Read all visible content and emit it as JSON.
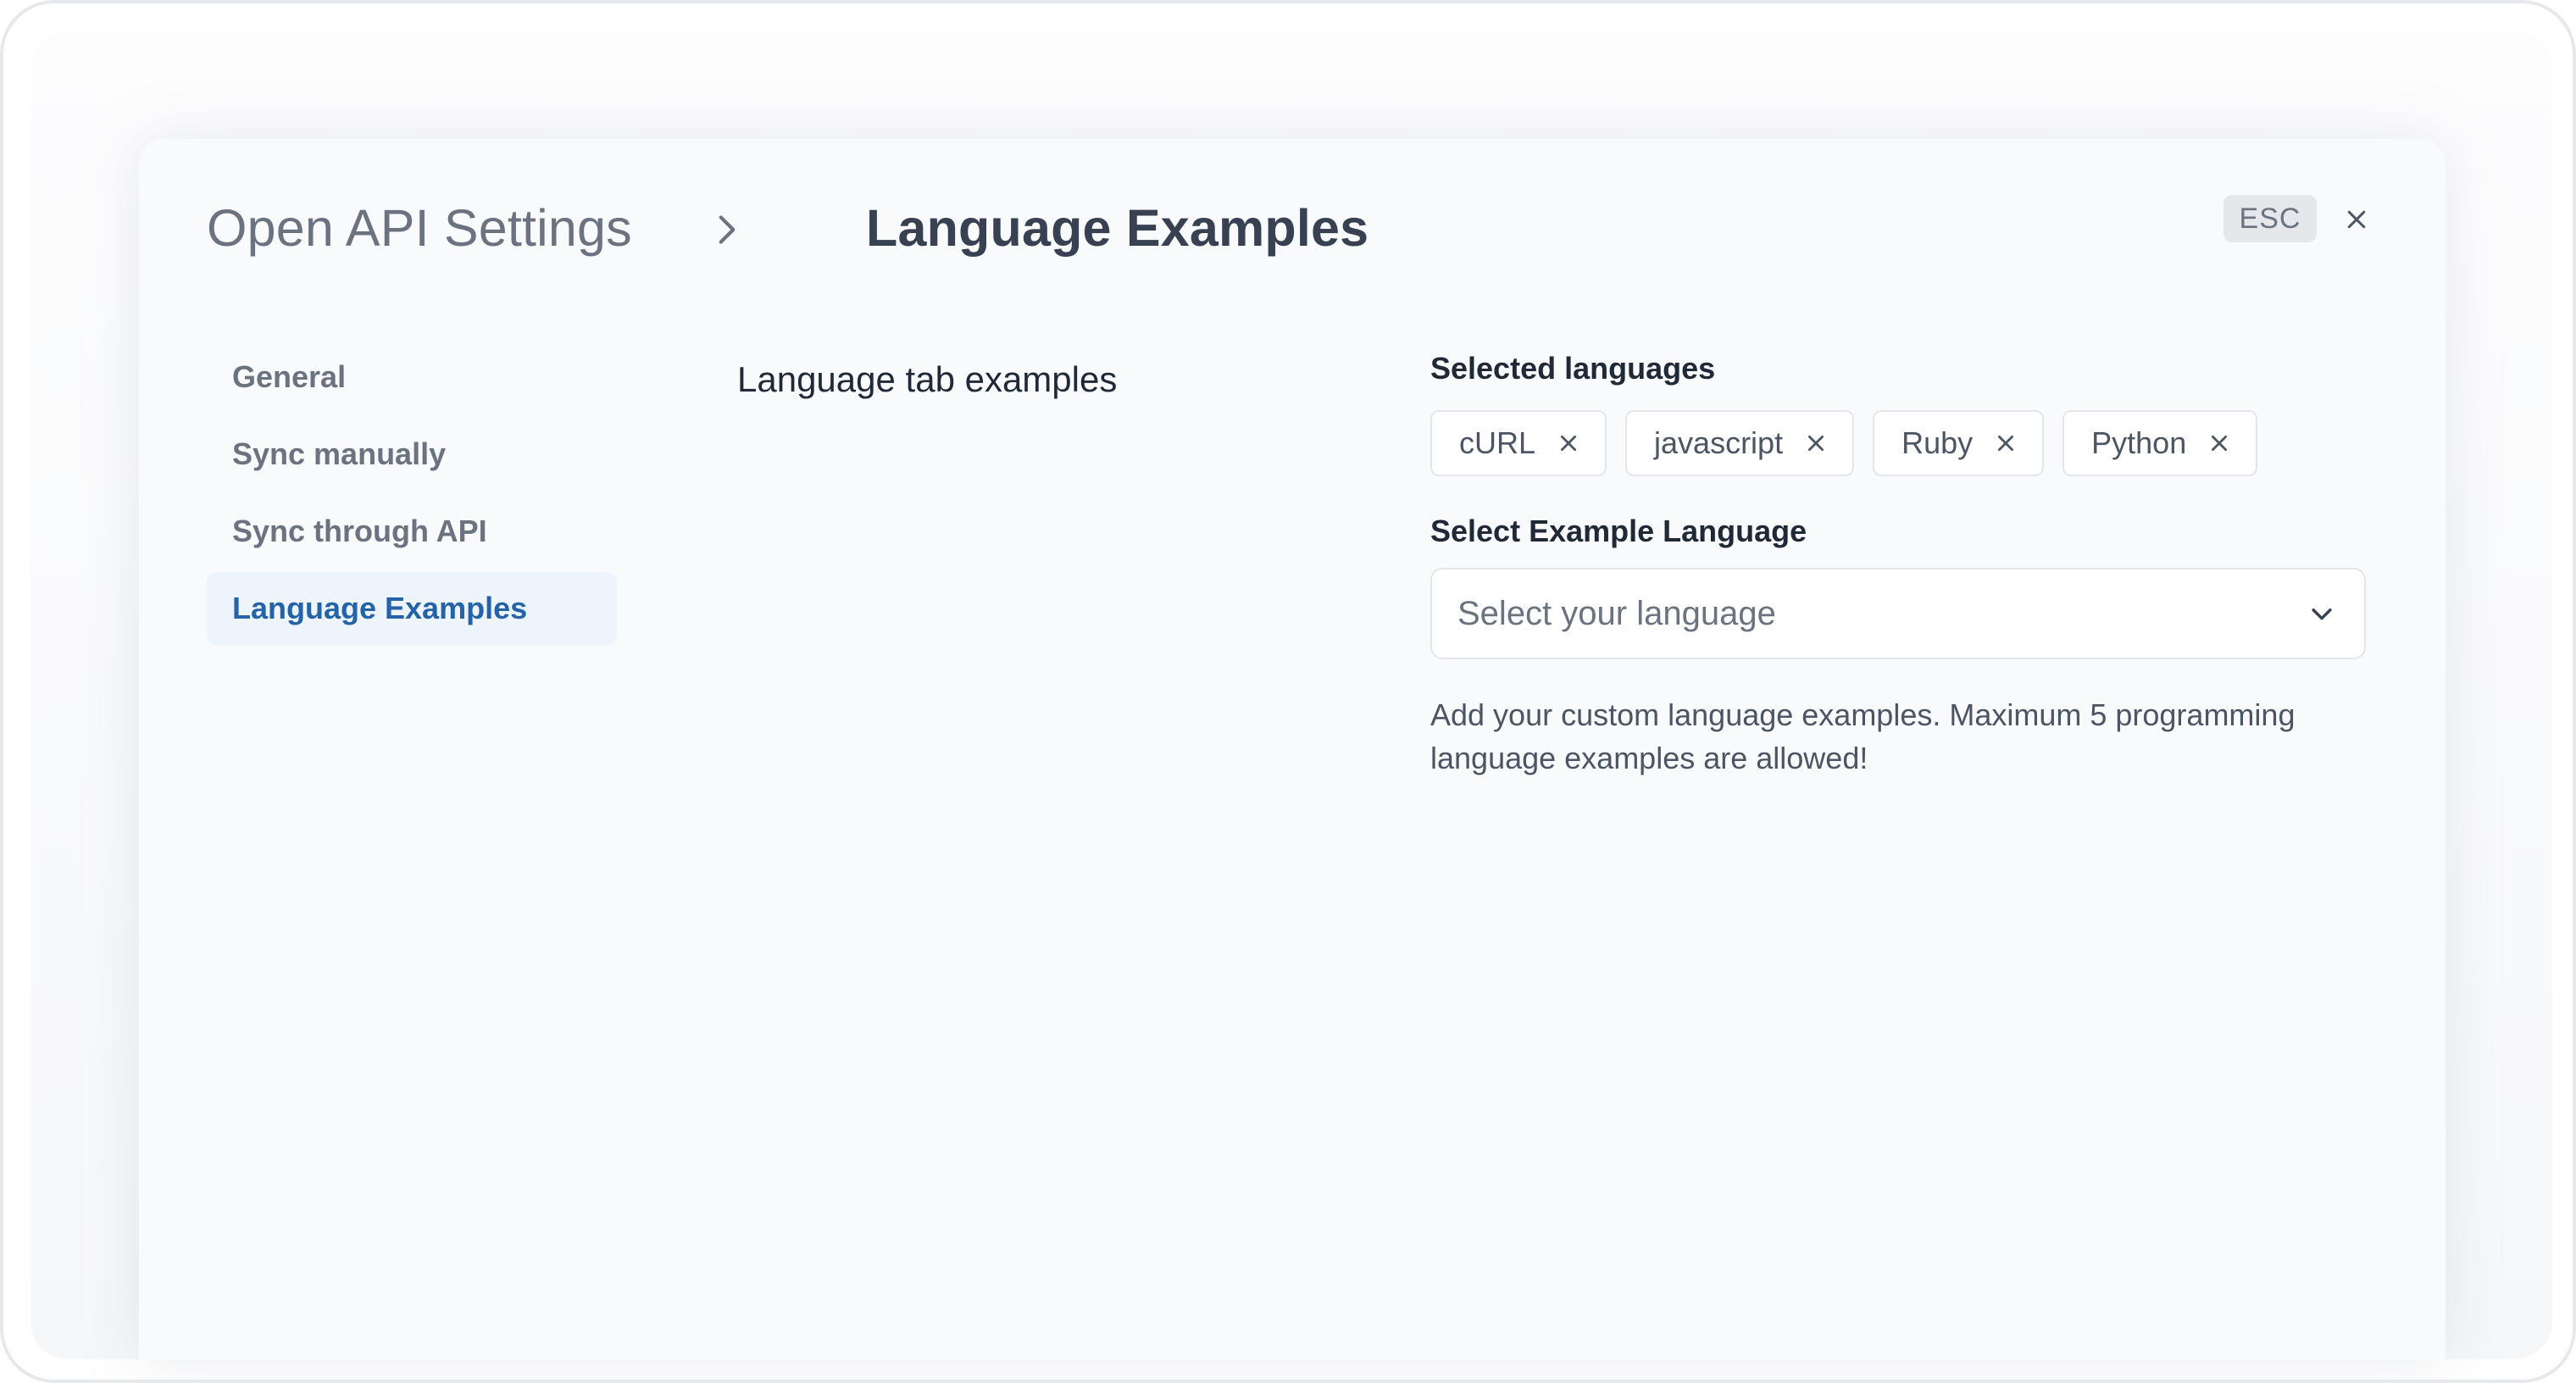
{
  "header": {
    "breadcrumb_parent": "Open API Settings",
    "breadcrumb_current": "Language Examples",
    "esc_label": "ESC"
  },
  "sidebar": {
    "items": [
      {
        "label": "General",
        "active": false
      },
      {
        "label": "Sync manually",
        "active": false
      },
      {
        "label": "Sync through API",
        "active": false
      },
      {
        "label": "Language Examples",
        "active": true
      }
    ]
  },
  "main": {
    "section_title": "Language tab examples",
    "selected_languages_label": "Selected languages",
    "selected_languages": [
      "cURL",
      "javascript",
      "Ruby",
      "Python"
    ],
    "select_label": "Select Example Language",
    "select_placeholder": "Select your language",
    "help_text": "Add your custom language examples. Maximum 5 programming language examples are allowed!"
  },
  "colors": {
    "accent": "#2563a8",
    "active_bg": "#eef4fc",
    "text_muted": "#6b7280",
    "text_dark": "#1f2937"
  },
  "icons": {
    "breadcrumb_separator": "chevron-right-icon",
    "close": "close-icon",
    "chip_remove": "x-icon",
    "select_toggle": "chevron-down-icon"
  }
}
